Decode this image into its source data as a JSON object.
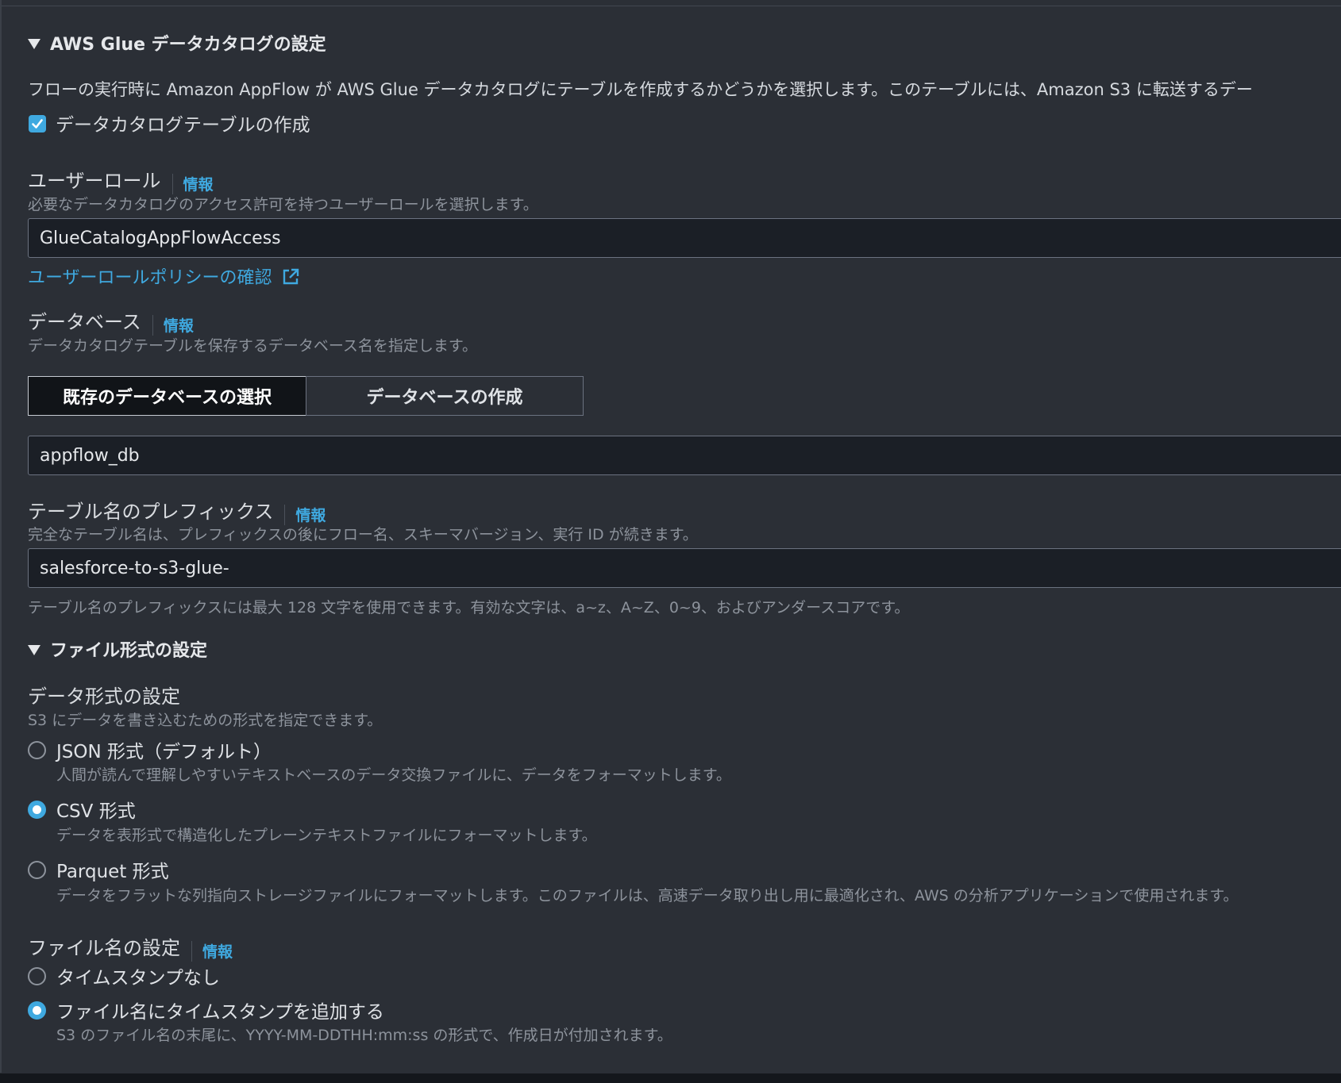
{
  "glue": {
    "title": "AWS Glue データカタログの設定",
    "description": "フローの実行時に Amazon AppFlow が AWS Glue データカタログにテーブルを作成するかどうかを選択します。このテーブルには、Amazon S3 に転送するデー",
    "create_table_label": "データカタログテーブルの作成",
    "create_table_checked": true
  },
  "user_role": {
    "label": "ユーザーロール",
    "info": "情報",
    "hint": "必要なデータカタログのアクセス許可を持つユーザーロールを選択します。",
    "value": "GlueCatalogAppFlowAccess",
    "policy_link": "ユーザーロールポリシーの確認"
  },
  "database": {
    "label": "データベース",
    "info": "情報",
    "hint": "データカタログテーブルを保存するデータベース名を指定します。",
    "seg_existing": "既存のデータベースの選択",
    "seg_create": "データベースの作成",
    "selected_segment": "既存のデータベースの選択",
    "value": "appflow_db"
  },
  "table_prefix": {
    "label": "テーブル名のプレフィックス",
    "info": "情報",
    "hint": "完全なテーブル名は、プレフィックスの後にフロー名、スキーマバージョン、実行 ID が続きます。",
    "value": "salesforce-to-s3-glue-",
    "constraint": "テーブル名のプレフィックスには最大 128 文字を使用できます。有効な文字は、a~z、A~Z、0~9、およびアンダースコアです。"
  },
  "file_format": {
    "title": "ファイル形式の設定",
    "data_format_label": "データ形式の設定",
    "data_format_hint": "S3 にデータを書き込むための形式を指定できます。",
    "options": [
      {
        "label": "JSON 形式（デフォルト）",
        "desc": "人間が読んで理解しやすいテキストベースのデータ交換ファイルに、データをフォーマットします。",
        "selected": false
      },
      {
        "label": "CSV 形式",
        "desc": "データを表形式で構造化したプレーンテキストファイルにフォーマットします。",
        "selected": true
      },
      {
        "label": "Parquet 形式",
        "desc": "データをフラットな列指向ストレージファイルにフォーマットします。このファイルは、高速データ取り出し用に最適化され、AWS の分析アプリケーションで使用されます。",
        "selected": false
      }
    ],
    "filename_label": "ファイル名の設定",
    "filename_info": "情報",
    "filename_options": [
      {
        "label": "タイムスタンプなし",
        "desc": "",
        "selected": false
      },
      {
        "label": "ファイル名にタイムスタンプを追加する",
        "desc": "S3 のファイル名の末尾に、YYYY-MM-DDTHH:mm:ss の形式で、作成日が付加されます。",
        "selected": true
      }
    ]
  },
  "colors": {
    "background": "#2b2f36",
    "input_bg": "#1b1f26",
    "accent": "#3fa9e0",
    "muted_text": "#8d939c"
  }
}
